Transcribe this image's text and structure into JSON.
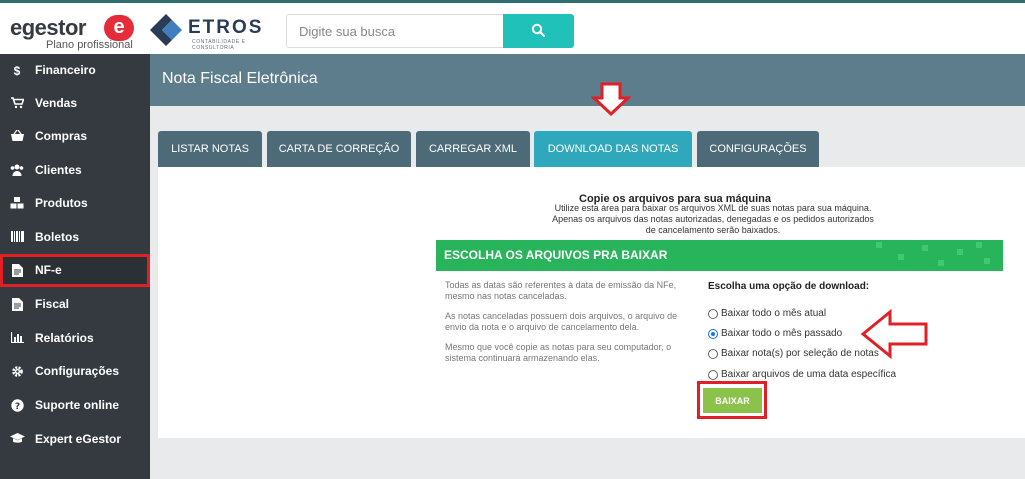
{
  "header": {
    "egestor_logo_text": "egestor",
    "egestor_logo_badge": "e",
    "egestor_plan": "Plano profissional",
    "etros_brand": "ETROS",
    "etros_sub": "CONTABILIDADE E CONSULTORIA",
    "search_placeholder": "Digite sua busca"
  },
  "sidebar": {
    "items": [
      {
        "label": "Financeiro",
        "icon": "dollar-icon",
        "glyph": "$"
      },
      {
        "label": "Vendas",
        "icon": "cart-icon",
        "glyph": "🛒"
      },
      {
        "label": "Compras",
        "icon": "basket-icon",
        "glyph": "🧺"
      },
      {
        "label": "Clientes",
        "icon": "users-icon",
        "glyph": "👥"
      },
      {
        "label": "Produtos",
        "icon": "cubes-icon",
        "glyph": "⬢"
      },
      {
        "label": "Boletos",
        "icon": "barcode-icon",
        "glyph": "▥"
      },
      {
        "label": "NF-e",
        "icon": "document-icon",
        "glyph": "▤"
      },
      {
        "label": "Fiscal",
        "icon": "document-icon",
        "glyph": "▤"
      },
      {
        "label": "Relatórios",
        "icon": "bar-chart-icon",
        "glyph": "▮"
      },
      {
        "label": "Configurações",
        "icon": "gear-icon",
        "glyph": "⚙"
      },
      {
        "label": "Suporte online",
        "icon": "question-icon",
        "glyph": "?"
      },
      {
        "label": "Expert eGestor",
        "icon": "graduation-cap-icon",
        "glyph": "🎓"
      }
    ],
    "active_item": "NF-e"
  },
  "main": {
    "title": "Nota Fiscal Eletrônica",
    "tabs": [
      {
        "label": "LISTAR NOTAS"
      },
      {
        "label": "CARTA DE CORREÇÃO"
      },
      {
        "label": "CARREGAR XML"
      },
      {
        "label": "DOWNLOAD DAS NOTAS"
      },
      {
        "label": "CONFIGURAÇÕES"
      }
    ],
    "active_tab": "DOWNLOAD DAS NOTAS",
    "copy_title": "Copie os arquivos para sua máquina",
    "copy_description": "Utilize esta área para baixar os arquivos XML de suas notas para sua máquina. Apenas os arquivos das notas autorizadas, denegadas e os pedidos autorizados de cancelamento serão baixados.",
    "section_title": "ESCOLHA OS ARQUIVOS PRA BAIXAR",
    "info": [
      "Todas as datas são referentes à data de emissão da NFe, mesmo nas notas canceladas.",
      "As notas canceladas possuem dois arquivos, o arquivo de envio da nota e o arquivo de cancelamento dela.",
      "Mesmo que você copie as notas para seu computador, o sistema continuará armazenando elas."
    ],
    "options_title": "Escolha uma opção de download:",
    "options": [
      {
        "label": "Baixar todo o mês atual",
        "checked": false
      },
      {
        "label": "Baixar todo o mês passado",
        "checked": true
      },
      {
        "label": "Baixar nota(s) por seleção de notas",
        "checked": false
      },
      {
        "label": "Baixar arquivos de uma data específica",
        "checked": false
      }
    ],
    "download_button": "BAIXAR"
  },
  "colors": {
    "sidebar_bg": "#343a40",
    "header_bar": "#5d7d8d",
    "tab_bg": "#4d6a79",
    "tab_active": "#2fa8bc",
    "accent_teal": "#20c1b9",
    "section_green": "#27b45b",
    "button_green": "#8bc34a",
    "highlight_red": "#e01f26"
  }
}
